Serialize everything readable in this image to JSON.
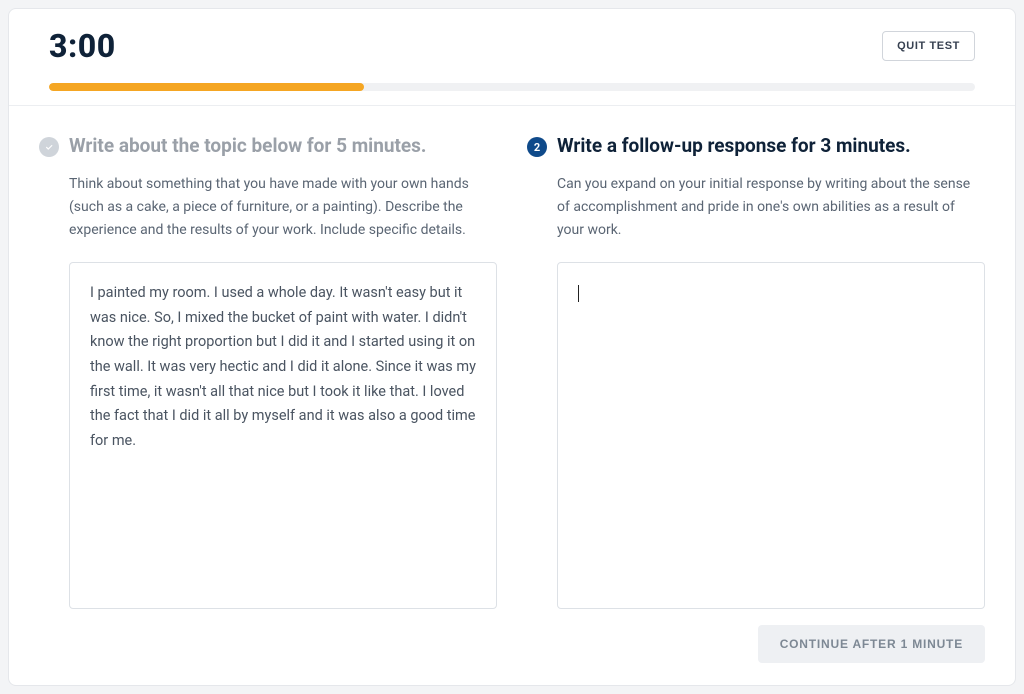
{
  "header": {
    "timer": "3:00",
    "quit_label": "QUIT TEST"
  },
  "progress": {
    "percent": 34
  },
  "left": {
    "title": "Write about the topic below for 5 minutes.",
    "desc": "Think about something that you have made with your own hands (such as a cake, a piece of furniture, or a painting). Describe the experience and the results of your work. Include specific details.",
    "response": "I painted my room. I used a whole day. It wasn't easy but it was nice. So, I mixed the bucket of paint with water. I didn't know the right proportion but I did it and I started using it on the wall. It was very hectic and I did it alone. Since it was my first time, it wasn't all that nice but I took it like that. I loved the fact that I did it all by myself and it was also a good time for me."
  },
  "right": {
    "step_number": "2",
    "title": "Write a follow-up response for 3 minutes.",
    "desc": "Can you expand on your initial response by writing about the sense of accomplishment and pride in one's own abilities as a result of your work.",
    "response": ""
  },
  "footer": {
    "continue_label": "CONTINUE AFTER 1 MINUTE"
  }
}
